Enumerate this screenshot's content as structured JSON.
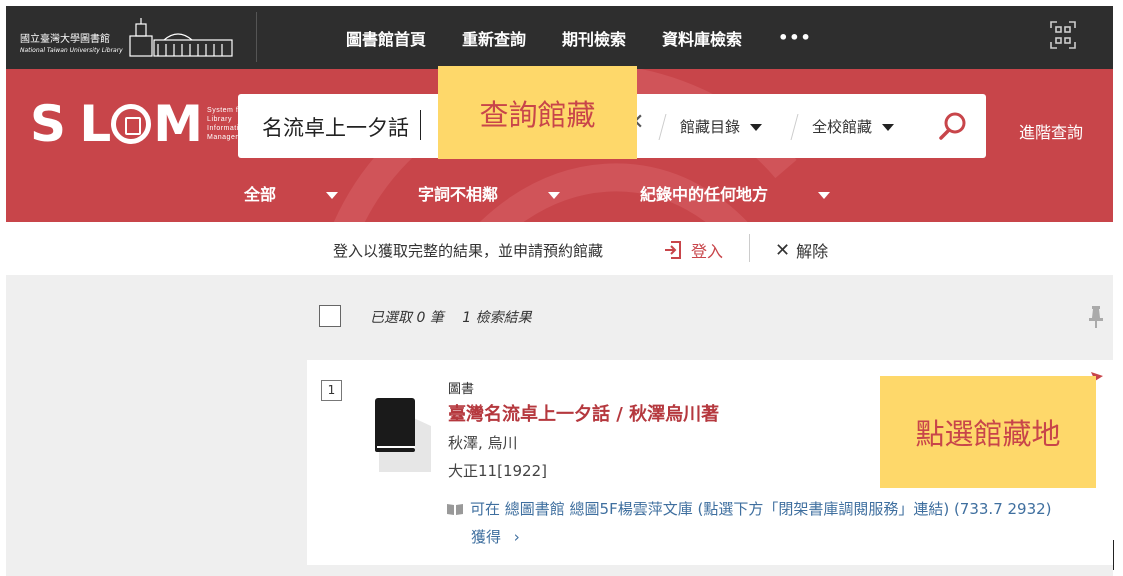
{
  "header": {
    "library_name_zh": "國立臺灣大學圖書館",
    "library_name_en": "National Taiwan University Library",
    "nav": [
      "圖書館首頁",
      "重新查詢",
      "期刊檢索",
      "資料庫檢索",
      "•••"
    ]
  },
  "brand": {
    "slim_sub": [
      "System for",
      "Library",
      "Information",
      "Management"
    ]
  },
  "search": {
    "query": "名流卓上一夕話",
    "scope_catalog": "館藏目錄",
    "scope_campus": "全校館藏",
    "advanced": "進階查詢"
  },
  "filters": [
    "全部",
    "字詞不相鄰",
    "紀錄中的任何地方"
  ],
  "callouts": {
    "search_collection": "查詢館藏",
    "select_location": "點選館藏地"
  },
  "login_bar": {
    "message": "登入以獲取完整的結果，並申請預約館藏",
    "login": "登入",
    "dismiss": "解除"
  },
  "results": {
    "selected": "已選取 0 筆",
    "count": "1 檢索結果",
    "items": [
      {
        "index": "1",
        "type": "圖書",
        "title": "臺灣名流卓上一夕話 / 秋澤烏川著",
        "author": "秋澤, 烏川",
        "date": "大正11[1922]",
        "availability": "可在  總圖書館  總圖5F楊雲萍文庫 (點選下方「閉架書庫調閱服務」連結) (733.7 2932)",
        "get": "獲得",
        "get_arrow": "›"
      }
    ]
  },
  "colors": {
    "brand_red": "#c8454a",
    "nav_dark": "#2e2e2e",
    "callout_yellow": "#fed86a",
    "link_blue": "#3f6f9f"
  }
}
